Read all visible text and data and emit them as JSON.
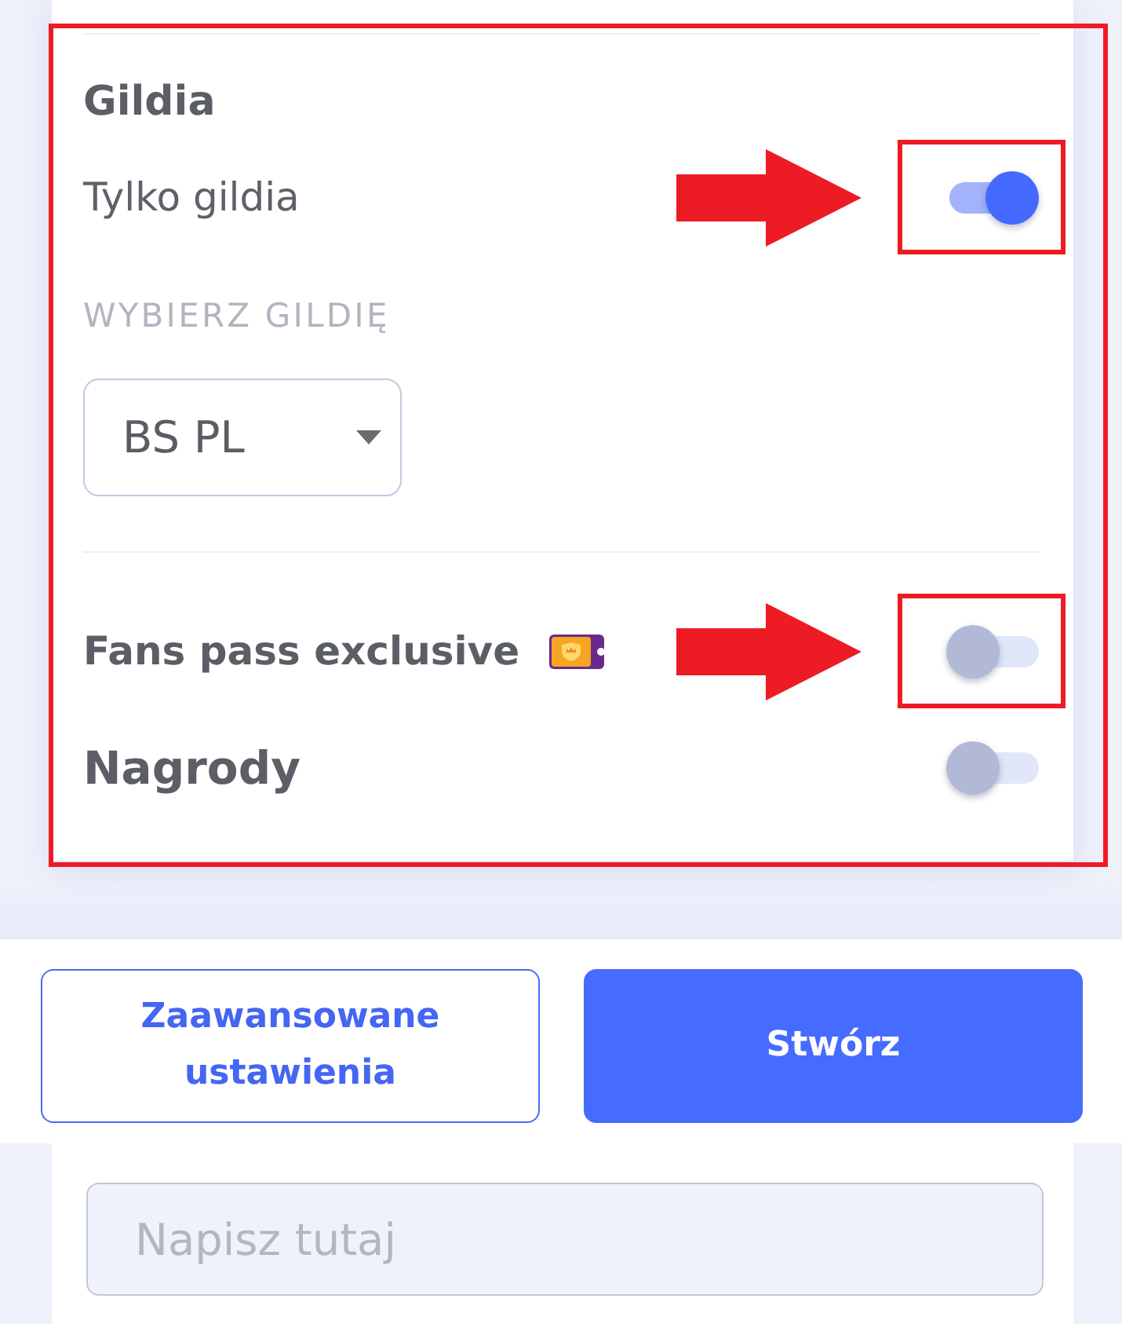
{
  "panel": {
    "highlighted": true,
    "section_title": "Gildia",
    "guild_only": {
      "label": "Tylko gildia",
      "on": true,
      "highlighted": true
    },
    "guild_select": {
      "label": "WYBIERZ GILDIĘ",
      "value": "BS PL"
    },
    "fans_pass": {
      "label": "Fans pass exclusive",
      "on": false,
      "highlighted": true
    },
    "rewards": {
      "label": "Nagrody",
      "on": false,
      "highlighted": false
    }
  },
  "buttons": [
    {
      "label": "Zaawansowane ustawienia",
      "kind": "outline"
    },
    {
      "label": "Stwórz",
      "kind": "primary"
    }
  ],
  "message_field": {
    "placeholder": "Napisz tutaj"
  }
}
